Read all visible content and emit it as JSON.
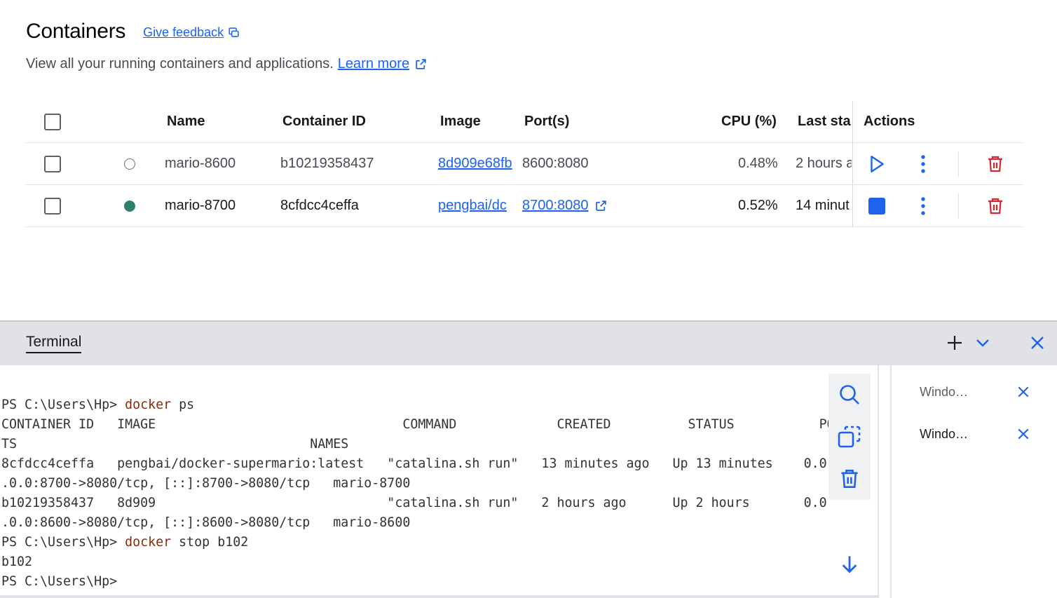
{
  "header": {
    "title": "Containers",
    "feedback_label": "Give feedback",
    "subtitle": "View all your running containers and applications.",
    "learn_more": "Learn more"
  },
  "table": {
    "columns": {
      "name": "Name",
      "container_id": "Container ID",
      "image": "Image",
      "ports": "Port(s)",
      "cpu": "CPU (%)",
      "last_started": "Last sta",
      "actions": "Actions"
    },
    "rows": [
      {
        "status": "stopped",
        "name": "mario-8600",
        "container_id": "b10219358437",
        "image": "8d909e68fb",
        "port": "8600:8080",
        "cpu": "0.48%",
        "last_started": "2 hours a"
      },
      {
        "status": "running",
        "name": "mario-8700",
        "container_id": "8cfdcc4ceffa",
        "image": "pengbai/dc",
        "port": "8700:8080",
        "cpu": "0.52%",
        "last_started": "14 minut"
      }
    ]
  },
  "terminal": {
    "tab_label": "Terminal",
    "prompt": "PS C:\\Users\\Hp> ",
    "lines": {
      "l1_cmd": "docker",
      "l1_args": " ps",
      "l2": "CONTAINER ID   IMAGE                                COMMAND             CREATED          STATUS           POR",
      "l3": "TS                                      NAMES",
      "l4": "8cfdcc4ceffa   pengbai/docker-supermario:latest   \"catalina.sh run\"   13 minutes ago   Up 13 minutes    0.0",
      "l5": ".0.0:8700->8080/tcp, [::]:8700->8080/tcp   mario-8700",
      "l6": "b10219358437   8d909                              \"catalina.sh run\"   2 hours ago      Up 2 hours       0.0",
      "l7": ".0.0:8600->8080/tcp, [::]:8600->8080/tcp   mario-8600",
      "l8_cmd": "docker",
      "l8_args": " stop b102",
      "l9": "b102"
    },
    "sessions": [
      {
        "label": "Windo…",
        "active": false
      },
      {
        "label": "Windo…",
        "active": true
      }
    ]
  },
  "colors": {
    "accent": "#1d63ed",
    "danger": "#d52536",
    "running": "#2d7f6e",
    "command": "#8b2a0b"
  },
  "icons": [
    "external-link-icon",
    "feedback-icon",
    "play-icon",
    "stop-icon",
    "more-vertical-icon",
    "trash-icon",
    "plus-icon",
    "chevron-down-icon",
    "close-icon",
    "search-icon",
    "copy-icon",
    "arrow-down-icon"
  ]
}
